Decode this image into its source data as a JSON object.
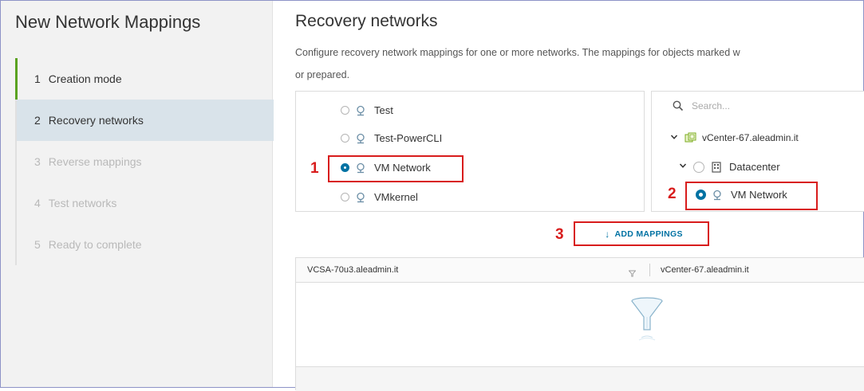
{
  "sidebar": {
    "title": "New Network Mappings",
    "steps": [
      {
        "num": "1",
        "label": "Creation mode"
      },
      {
        "num": "2",
        "label": "Recovery networks"
      },
      {
        "num": "3",
        "label": "Reverse mappings"
      },
      {
        "num": "4",
        "label": "Test networks"
      },
      {
        "num": "5",
        "label": "Ready to complete"
      }
    ]
  },
  "main": {
    "title": "Recovery networks",
    "description_line1": "Configure recovery network mappings for one or more networks. The mappings for objects marked w",
    "description_line2": "or prepared."
  },
  "source_networks": [
    {
      "label": "Test",
      "selected": false
    },
    {
      "label": "Test-PowerCLI",
      "selected": false
    },
    {
      "label": "VM Network",
      "selected": true
    },
    {
      "label": "VMkernel",
      "selected": false
    }
  ],
  "target_tree": {
    "search_placeholder": "Search...",
    "vcenter": "vCenter-67.aleadmin.it",
    "datacenter": "Datacenter",
    "network": "VM Network"
  },
  "add_button": {
    "label": "ADD MAPPINGS",
    "arrow": "↓"
  },
  "grid": {
    "columns": [
      "VCSA-70u3.aleadmin.it",
      "vCenter-67.aleadmin.it"
    ]
  },
  "annotations": [
    "1",
    "2",
    "3"
  ],
  "colors": {
    "accent": "#0072a3",
    "annotation": "#d81c1c",
    "done": "#5aa220"
  }
}
